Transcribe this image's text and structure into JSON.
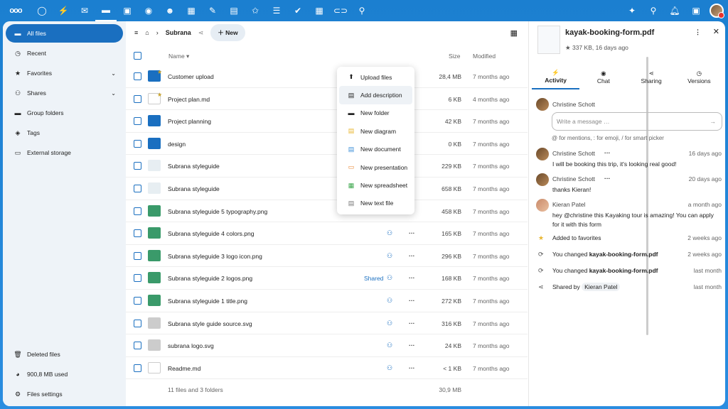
{
  "topbar": {
    "logo": "ooo",
    "apps": [
      "dashboard-icon",
      "activity-icon",
      "mail-icon",
      "files-icon",
      "photos-icon",
      "talk-icon",
      "contacts-icon",
      "calendar-icon",
      "notes-icon",
      "deck-icon",
      "stars-icon",
      "tasks-icon",
      "forms-icon",
      "tables-icon",
      "links-icon",
      "maps-icon"
    ],
    "right": [
      "assistant-icon",
      "search-icon",
      "notifications-icon",
      "contacts-menu-icon"
    ]
  },
  "sidebar": {
    "items": [
      {
        "label": "All files",
        "icon": "folder-icon"
      },
      {
        "label": "Recent",
        "icon": "history-icon"
      },
      {
        "label": "Favorites",
        "icon": "star-icon"
      },
      {
        "label": "Shares",
        "icon": "share-icon"
      },
      {
        "label": "Group folders",
        "icon": "group-folder-icon"
      },
      {
        "label": "Tags",
        "icon": "tag-icon"
      },
      {
        "label": "External storage",
        "icon": "external-icon"
      }
    ],
    "bottom": [
      {
        "label": "Deleted files"
      },
      {
        "label": "900,8 MB used"
      },
      {
        "label": "Files settings"
      }
    ]
  },
  "breadcrumb": {
    "current": "Subrana",
    "new_label": "New"
  },
  "table": {
    "col_name": "Name",
    "col_size": "Size",
    "col_modified": "Modified",
    "shared_label": "Shared",
    "rows": [
      {
        "name": "Customer upload",
        "size": "28,4 MB",
        "modified": "7 months ago",
        "shared": true,
        "fav": true
      },
      {
        "name": "Project plan.md",
        "size": "6 KB",
        "modified": "4 months ago",
        "shared": true,
        "fav": true
      },
      {
        "name": "Project planning",
        "size": "42 KB",
        "modified": "7 months ago",
        "shared": false
      },
      {
        "name": "design",
        "size": "0 KB",
        "modified": "7 months ago",
        "shared": false
      },
      {
        "name": "Subrana styleguide",
        "size": "229 KB",
        "modified": "7 months ago",
        "shared": false
      },
      {
        "name": "Subrana styleguide",
        "size": "658 KB",
        "modified": "7 months ago",
        "shared": true
      },
      {
        "name": "Subrana styleguide 5 typography.png",
        "size": "458 KB",
        "modified": "7 months ago",
        "shared": false
      },
      {
        "name": "Subrana styleguide 4 colors.png",
        "size": "165 KB",
        "modified": "7 months ago",
        "shared": false
      },
      {
        "name": "Subrana styleguide 3 logo icon.png",
        "size": "296 KB",
        "modified": "7 months ago",
        "shared": false
      },
      {
        "name": "Subrana styleguide 2 logos.png",
        "size": "168 KB",
        "modified": "7 months ago",
        "shared": true
      },
      {
        "name": "Subrana styleguide 1 title.png",
        "size": "272 KB",
        "modified": "7 months ago",
        "shared": false
      },
      {
        "name": "Subrana style guide source.svg",
        "size": "316 KB",
        "modified": "7 months ago",
        "shared": false
      },
      {
        "name": "subrana logo.svg",
        "size": "24 KB",
        "modified": "7 months ago",
        "shared": false
      },
      {
        "name": "Readme.md",
        "size": "< 1 KB",
        "modified": "7 months ago",
        "shared": false
      }
    ],
    "summary_count": "11 files and 3 folders",
    "summary_size": "30,9 MB"
  },
  "newmenu": [
    "Upload files",
    "Add description",
    "New folder",
    "New diagram",
    "New document",
    "New presentation",
    "New spreadsheet",
    "New text file"
  ],
  "panel": {
    "title": "kayak-booking-form.pdf",
    "meta": "★ 337 KB, 16 days ago",
    "tabs": [
      "Activity",
      "Chat",
      "Sharing",
      "Versions"
    ],
    "composer_user": "Christine Schott",
    "placeholder": "Write a message …",
    "hint": "@ for mentions, : for emoji, / for smart picker",
    "comments": [
      {
        "name": "Christine Schott",
        "time": "16 days ago",
        "text": "I will be booking this trip, it's looking real good!"
      },
      {
        "name": "Christine Schott",
        "time": "20 days ago",
        "text": "thanks Kieran!"
      },
      {
        "name": "Kieran Patel",
        "time": "a month ago",
        "text": "hey @christine this Kayaking tour is amazing! You can apply for it with this form"
      }
    ],
    "events": [
      {
        "text": "Added to favorites",
        "time": "2 weeks ago"
      },
      {
        "pre": "You changed ",
        "bold": "kayak-booking-form.pdf",
        "time": "2 weeks ago"
      },
      {
        "pre": "You changed ",
        "bold": "kayak-booking-form.pdf",
        "time": "last month"
      },
      {
        "pre": "Shared by ",
        "bold": "Kieran Patel",
        "time": "last month"
      }
    ]
  }
}
